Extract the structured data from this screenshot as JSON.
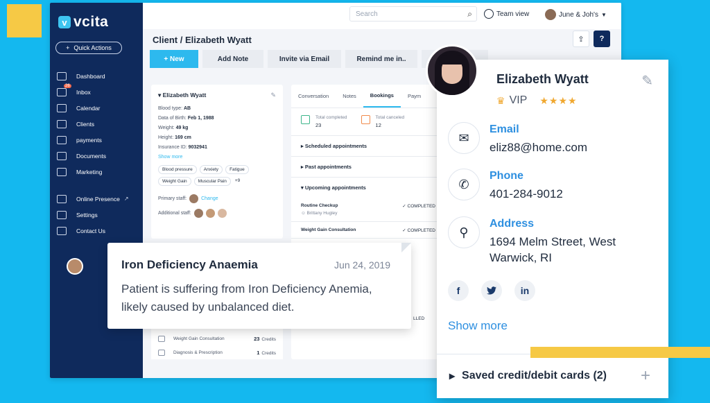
{
  "app": {
    "logo_text": "vcita",
    "logo_mark": "v",
    "quick_actions": "Quick Actions",
    "nav": [
      {
        "label": "Dashboard",
        "icon": "dashboard-icon"
      },
      {
        "label": "Inbox",
        "icon": "inbox-icon",
        "badge": "26"
      },
      {
        "label": "Calendar",
        "icon": "calendar-icon"
      },
      {
        "label": "Clients",
        "icon": "clients-icon"
      },
      {
        "label": "payments",
        "icon": "payments-icon"
      },
      {
        "label": "Documents",
        "icon": "documents-icon"
      },
      {
        "label": "Marketing",
        "icon": "marketing-icon"
      },
      {
        "label": "Online Presence",
        "icon": "globe-icon"
      },
      {
        "label": "Settings",
        "icon": "gear-icon"
      },
      {
        "label": "Contact Us",
        "icon": "mail-icon"
      }
    ]
  },
  "topbar": {
    "search_placeholder": "Search",
    "team_view": "Team view",
    "account": "June & Joh's"
  },
  "page": {
    "title": "Client / Elizabeth Wyatt",
    "actions": [
      "+ New",
      "Add Note",
      "Invite via Email",
      "Remind me in.."
    ]
  },
  "client_card": {
    "name": "Elizabeth Wyatt",
    "rows": [
      {
        "label": "Blood type:",
        "value": "AB"
      },
      {
        "label": "Data of Birth:",
        "value": "Feb 1, 1988"
      },
      {
        "label": "Weight:",
        "value": "49 kg"
      },
      {
        "label": "Height:",
        "value": "169 cm"
      },
      {
        "label": "Insurance ID:",
        "value": "9032941"
      }
    ],
    "show_more": "Show more",
    "tags": [
      "Blood pressure",
      "Anxiety",
      "Fatigue",
      "Weight Gain",
      "Muscular Pain",
      "+9"
    ],
    "primary_staff": "Primary staff:",
    "change": "Change",
    "additional_staff": "Additional staff:"
  },
  "bookings": {
    "tabs": [
      "Conversation",
      "Notes",
      "Bookings",
      "Paym"
    ],
    "stats": [
      {
        "label": "Total completed",
        "value": "23"
      },
      {
        "label": "Total canceled",
        "value": "12"
      }
    ],
    "sections": {
      "scheduled": "Scheduled appointments",
      "past": "Past appointments",
      "upcoming": "Upcoming appointments"
    },
    "appointments": [
      {
        "name": "Routine Checkup",
        "staff": "Brittany Hugley",
        "status": "COMPLETED"
      },
      {
        "name": "Weight Gain Consultation",
        "staff": "",
        "status": "COMPLETED"
      }
    ],
    "partial_status": "LLED"
  },
  "credits": [
    {
      "name": "Weight Gain Consultation",
      "count": "23",
      "unit": "Credits"
    },
    {
      "name": "Diagnosis & Prescription",
      "count": "1",
      "unit": "Credits"
    }
  ],
  "note": {
    "title": "Iron Deficiency Anaemia",
    "date": "Jun 24, 2019",
    "body": "Patient is suffering from Iron Deficiency Anemia, likely caused by unbalanced diet."
  },
  "contact": {
    "name": "Elizabeth Wyatt",
    "tier": "VIP",
    "stars": "★★★★",
    "email_label": "Email",
    "email": "eliz88@home.com",
    "phone_label": "Phone",
    "phone": "401-284-9012",
    "address_label": "Address",
    "address_line1": "1694  Melm Street, West",
    "address_line2": "Warwick, RI",
    "socials": [
      "f",
      "t",
      "in"
    ],
    "show_more": "Show more",
    "saved_cards": "Saved credit/debit cards (2)"
  },
  "colors": {
    "background": "#14b8ef",
    "sidebar": "#0f2a5c",
    "accent": "#2db9ee",
    "deco_yellow": "#f6c945"
  }
}
